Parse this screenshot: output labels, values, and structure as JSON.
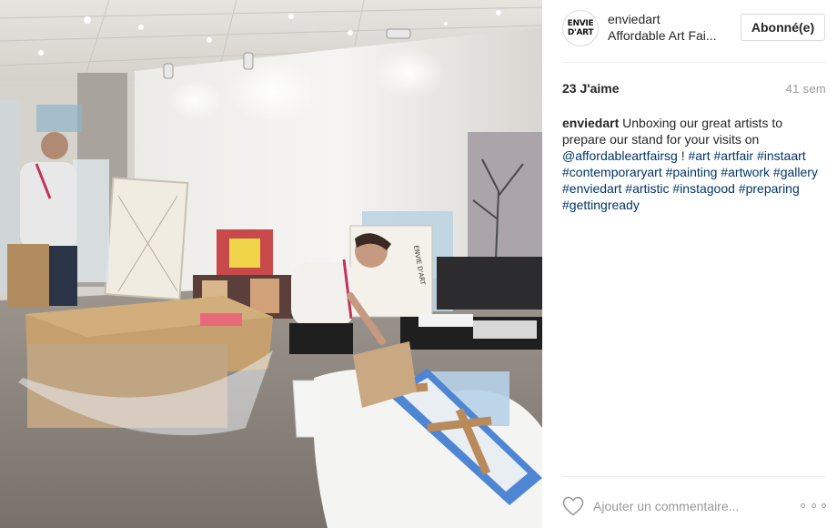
{
  "post": {
    "username": "enviedart",
    "location": "Affordable Art Fai...",
    "follow_label": "Abonné(e)",
    "avatar_lines": [
      "ENVIE",
      "D'ART"
    ]
  },
  "stats": {
    "likes": "23 J'aime",
    "time": "41 sem"
  },
  "caption": {
    "author": "enviedart",
    "text": " Unboxing our great artists to prepare our stand for your visits on ",
    "mention": "@affordableartfairsg",
    "after_mention": " ! ",
    "tags": [
      "#art",
      "#artfair",
      "#instaart",
      "#contemporaryart",
      "#painting",
      "#artwork",
      "#gallery",
      "#enviedart",
      "#artistic",
      "#instagood",
      "#preparing",
      "#gettingready"
    ]
  },
  "comment": {
    "placeholder": "Ajouter un commentaire..."
  },
  "colors": {
    "link": "#003569",
    "muted": "#999999",
    "border": "#dbdbdb"
  },
  "icons": {
    "like": "heart-outline-icon",
    "options": "more-options-icon"
  }
}
